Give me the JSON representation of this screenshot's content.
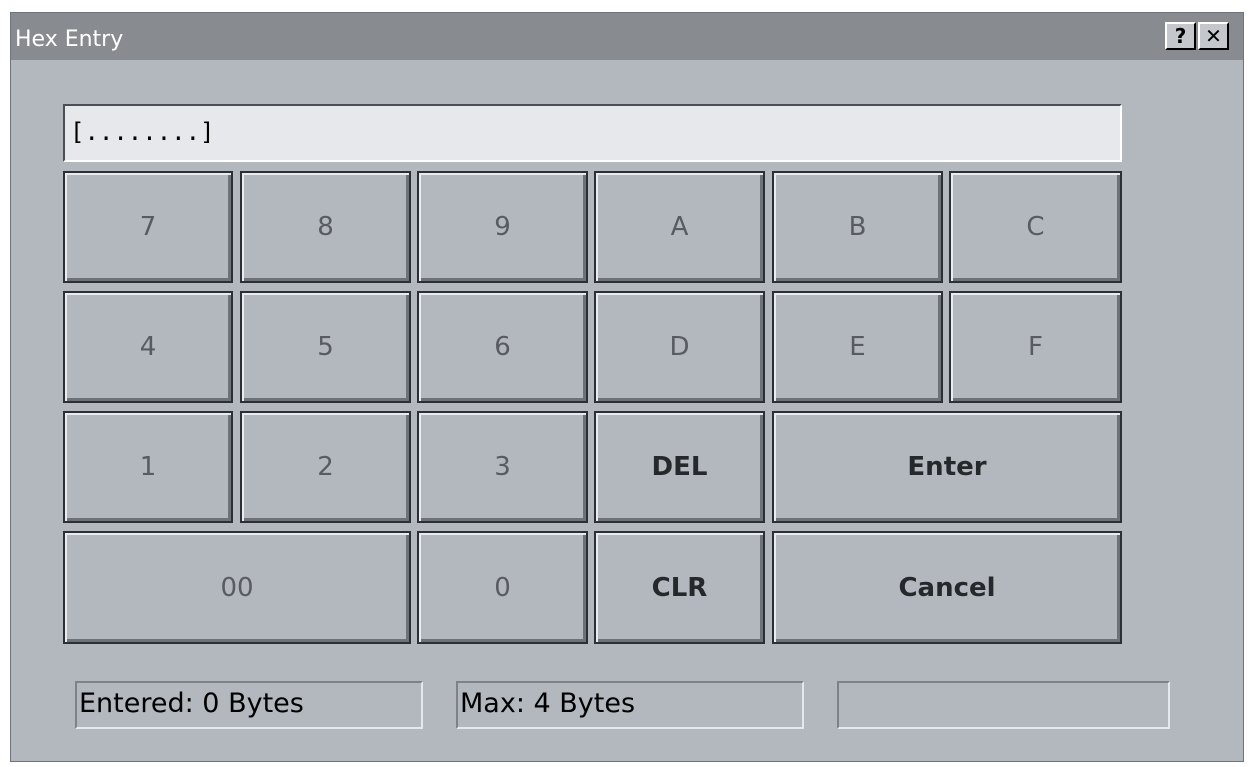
{
  "window": {
    "title": "Hex Entry",
    "help_label": "?",
    "close_label": "✕"
  },
  "display": {
    "value": "[........]"
  },
  "keypad": {
    "k7": "7",
    "k8": "8",
    "k9": "9",
    "kA": "A",
    "kB": "B",
    "kC": "C",
    "k4": "4",
    "k5": "5",
    "k6": "6",
    "kD": "D",
    "kE": "E",
    "kF": "F",
    "k1": "1",
    "k2": "2",
    "k3": "3",
    "del": "DEL",
    "enter": "Enter",
    "k00": "00",
    "k0": "0",
    "clr": "CLR",
    "cancel": "Cancel"
  },
  "status": {
    "entered": "Entered: 0 Bytes",
    "max": "Max: 4 Bytes",
    "extra": ""
  }
}
